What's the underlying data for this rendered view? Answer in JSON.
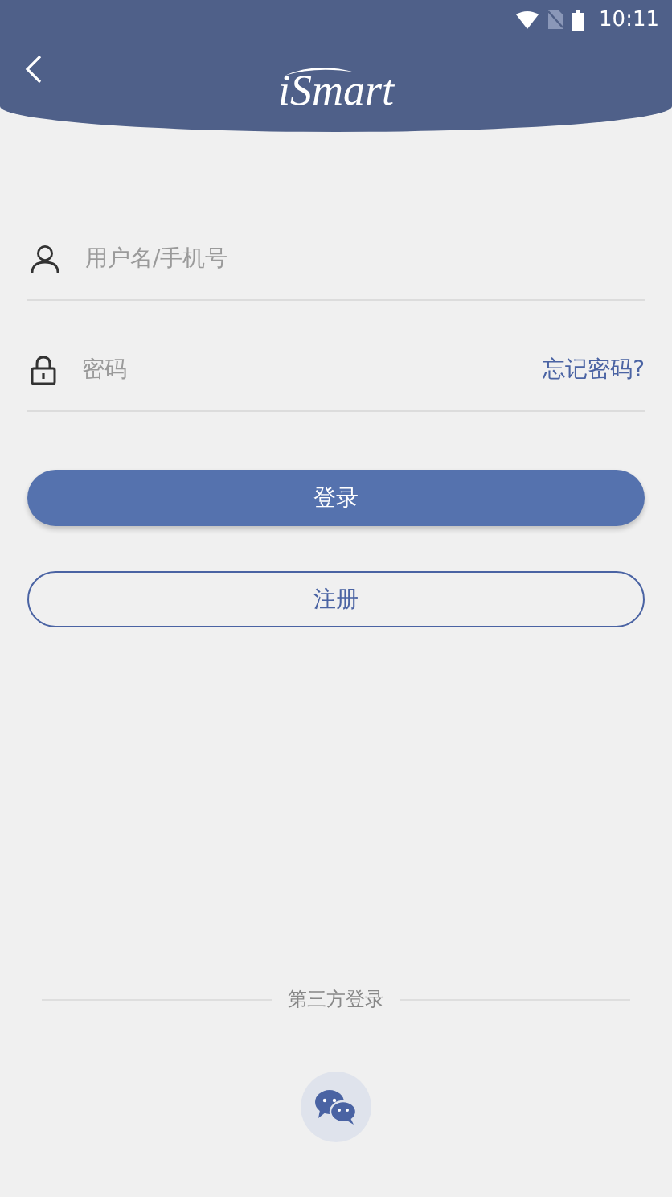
{
  "status_bar": {
    "time": "10:11"
  },
  "header": {
    "logo": "iSmart"
  },
  "fields": [
    {
      "kind": "user",
      "placeholder": "用户名/手机号"
    },
    {
      "kind": "password",
      "placeholder": "密码",
      "link": "忘记密码?"
    }
  ],
  "buttons": [
    {
      "kind": "primary",
      "label": "登录"
    },
    {
      "kind": "outline",
      "label": "注册"
    }
  ],
  "third_party": {
    "label": "第三方登录"
  }
}
